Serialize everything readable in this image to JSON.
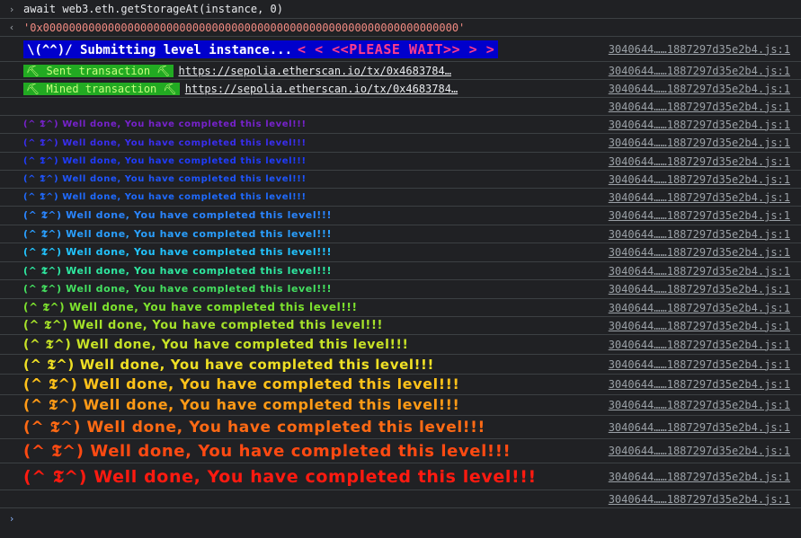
{
  "command": {
    "chevron": "›",
    "text": "await web3.eth.getStorageAt(instance, 0)"
  },
  "result": {
    "chevron": "‹",
    "text": "'0x0000000000000000000000000000000000000000000000000000000000000000'"
  },
  "source": "3040644……1887297d35e2b4.js:1",
  "banner": {
    "left": "\\(^^)/ Submitting level instance...",
    "right": "<  < <<PLEASE WAIT>> >  >"
  },
  "sent": {
    "badge": "⛏ Sent transaction ⛏",
    "url": "https://sepolia.etherscan.io/tx/0x4683784…"
  },
  "mined": {
    "badge": "⛏ Mined transaction ⛏",
    "url": "https://sepolia.etherscan.io/tx/0x4683784…"
  },
  "welldone": [
    {
      "text": "(^ 𝕿^) Well done, You have completed this level!!!",
      "color": "#7722cc"
    },
    {
      "text": "(^ 𝕿^) Well done, You have completed this level!!!",
      "color": "#3a2ef0"
    },
    {
      "text": "(^ 𝕿^) Well done, You have completed this level!!!",
      "color": "#1f3cff"
    },
    {
      "text": "(^ 𝕿^) Well done, You have completed this level!!!",
      "color": "#1f55ff"
    },
    {
      "text": "(^ 𝕿^) Well done, You have completed this level!!!",
      "color": "#1f6bff"
    },
    {
      "text": "(^ 𝕿^) Well done, You have completed this level!!!",
      "color": "#2a85ff"
    },
    {
      "text": "(^ 𝕿^) Well done, You have completed this level!!!",
      "color": "#2aa0ff"
    },
    {
      "text": "(^ 𝕿^) Well done, You have completed this level!!!",
      "color": "#22c4ff"
    },
    {
      "text": "(^ 𝕿^) Well done, You have completed this level!!!",
      "color": "#2ee8a0"
    },
    {
      "text": "(^ 𝕿^) Well done, You have completed this level!!!",
      "color": "#44e060"
    },
    {
      "text": "(^ 𝕿^) Well done, You have completed this level!!!",
      "color": "#7de22e"
    },
    {
      "text": "(^ 𝕿^) Well done, You have completed this level!!!",
      "color": "#a6e22a"
    },
    {
      "text": "(^ 𝕿^) Well done, You have completed this level!!!",
      "color": "#c8e226"
    },
    {
      "text": "(^ 𝕿^) Well done, You have completed this level!!!",
      "color": "#f0e024"
    },
    {
      "text": "(^ 𝕿^) Well done, You have completed this level!!!",
      "color": "#ffc21a"
    },
    {
      "text": "(^ 𝕿^) Well done, You have completed this level!!!",
      "color": "#ff9a16"
    },
    {
      "text": "(^ 𝕿^) Well done, You have completed this level!!!",
      "color": "#ff6a14"
    },
    {
      "text": "(^ 𝕿^) Well done, You have completed this level!!!",
      "color": "#ff4a12"
    },
    {
      "text": "(^ 𝕿^) Well done, You have completed this level!!!",
      "color": "#ff1a10"
    }
  ],
  "prompt": "›"
}
